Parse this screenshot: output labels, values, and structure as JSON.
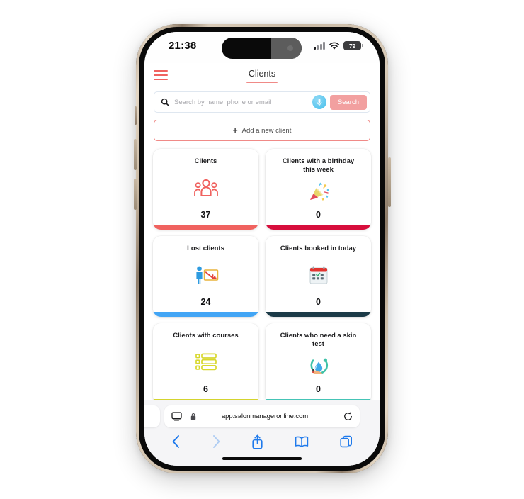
{
  "status_bar": {
    "time": "21:38",
    "battery_percent": "79",
    "signal_icon": "cellular-signal-icon",
    "wifi_icon": "wifi-icon",
    "battery_icon": "battery-icon"
  },
  "app": {
    "menu_icon": "hamburger-menu-icon",
    "title": "Clients",
    "search": {
      "icon": "search-icon",
      "placeholder": "Search by name, phone or email",
      "value": "",
      "mic_icon": "microphone-icon",
      "button_label": "Search",
      "button_color": "#F2A0A0",
      "mic_color": "#45BFEC"
    },
    "add_client": {
      "icon": "plus-icon",
      "label": "Add a new client",
      "border_color": "#F08A87"
    },
    "cards": [
      {
        "title": "Clients",
        "value": "37",
        "icon": "people-group-icon",
        "accent": "#F0625F"
      },
      {
        "title": "Clients with a birthday this week",
        "value": "0",
        "icon": "party-popper-icon",
        "accent": "#D70E3C"
      },
      {
        "title": "Lost clients",
        "value": "24",
        "icon": "person-with-declining-chart-icon",
        "accent": "#42A5F5"
      },
      {
        "title": "Clients booked in today",
        "value": "0",
        "icon": "calendar-icon",
        "accent": "#1B3A47"
      },
      {
        "title": "Clients with courses",
        "value": "6",
        "icon": "checklist-icon",
        "accent": "#D4D42E"
      },
      {
        "title": "Clients who need a skin test",
        "value": "0",
        "icon": "skin-test-droplet-icon",
        "accent": "#45C4B6"
      }
    ]
  },
  "browser": {
    "aa_icon": "page-settings-aa-icon",
    "lock_icon": "lock-icon",
    "url": "app.salonmanageronline.com",
    "reload_icon": "reload-icon",
    "toolbar": [
      {
        "icon": "back-arrow-icon",
        "enabled": true
      },
      {
        "icon": "forward-arrow-icon",
        "enabled": false
      },
      {
        "icon": "share-icon",
        "enabled": true
      },
      {
        "icon": "bookmarks-icon",
        "enabled": true
      },
      {
        "icon": "tabs-icon",
        "enabled": true
      }
    ]
  }
}
